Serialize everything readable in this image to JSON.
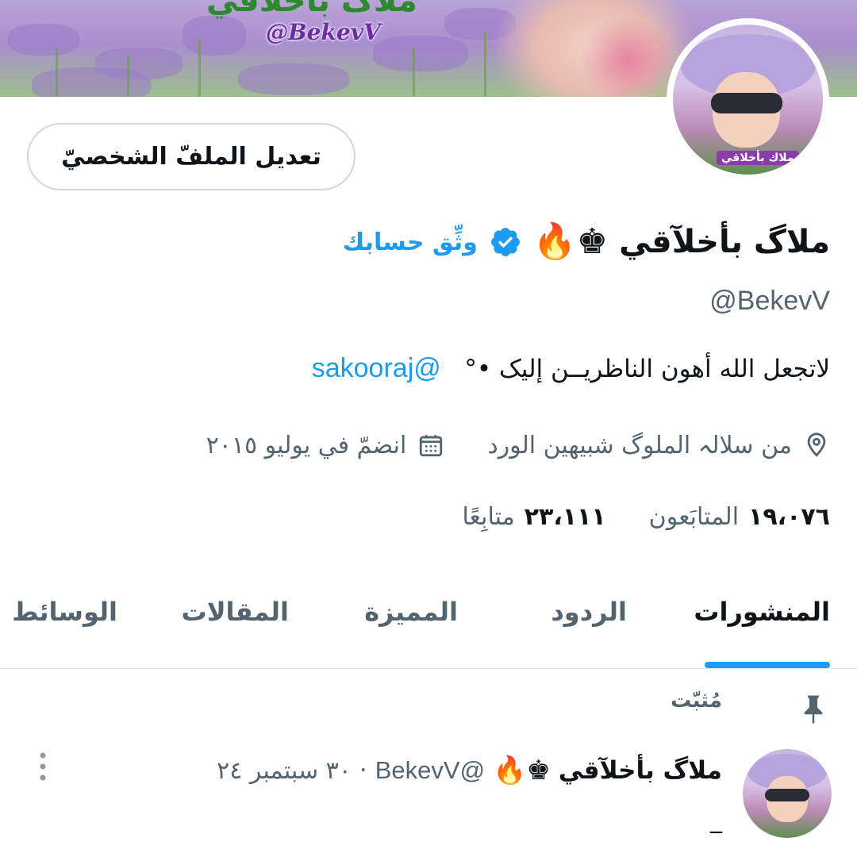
{
  "banner": {
    "title": "ملاگ بأخلاقي",
    "handle": "@BekevV"
  },
  "avatar": {
    "caption": "ملاك بأخلاقي"
  },
  "profile": {
    "edit_button_label": "تعديل الملفّ الشخصيّ",
    "name": "ملاگ بأخلآقي",
    "name_emoji": "♚🔥",
    "verify_link": "وثِّق حسابك",
    "handle": "@BekevV",
    "bio_text": "لاتجعل الله أهون الناظريــن إليک •°",
    "bio_mention": "@sakooraj",
    "location": "من سلالہ الملوگ شبيهين الورد",
    "joined": "انضمّ في يوليو ٢٠١٥",
    "following_count": "١٩،٠٧٦",
    "following_label": "المتابَعون",
    "followers_count": "٢٣،١١١",
    "followers_label": "متابِعًا"
  },
  "tabs": [
    {
      "label": "المنشورات",
      "active": true
    },
    {
      "label": "الردود",
      "active": false
    },
    {
      "label": "المميزة",
      "active": false
    },
    {
      "label": "المقالات",
      "active": false
    },
    {
      "label": "الوسائط",
      "active": false
    }
  ],
  "pinned": {
    "label": "مُثبّت"
  },
  "tweet": {
    "name": "ملاگ بأخلآقي",
    "name_emoji": "♚🔥",
    "handle": "@BekevV",
    "separator": "·",
    "time": "٣٠ سبتمبر ٢٤",
    "text": "_"
  },
  "colors": {
    "accent": "#1d9bf0",
    "text_primary": "#0f1419",
    "text_secondary": "#536471",
    "border": "#cfd9de"
  }
}
